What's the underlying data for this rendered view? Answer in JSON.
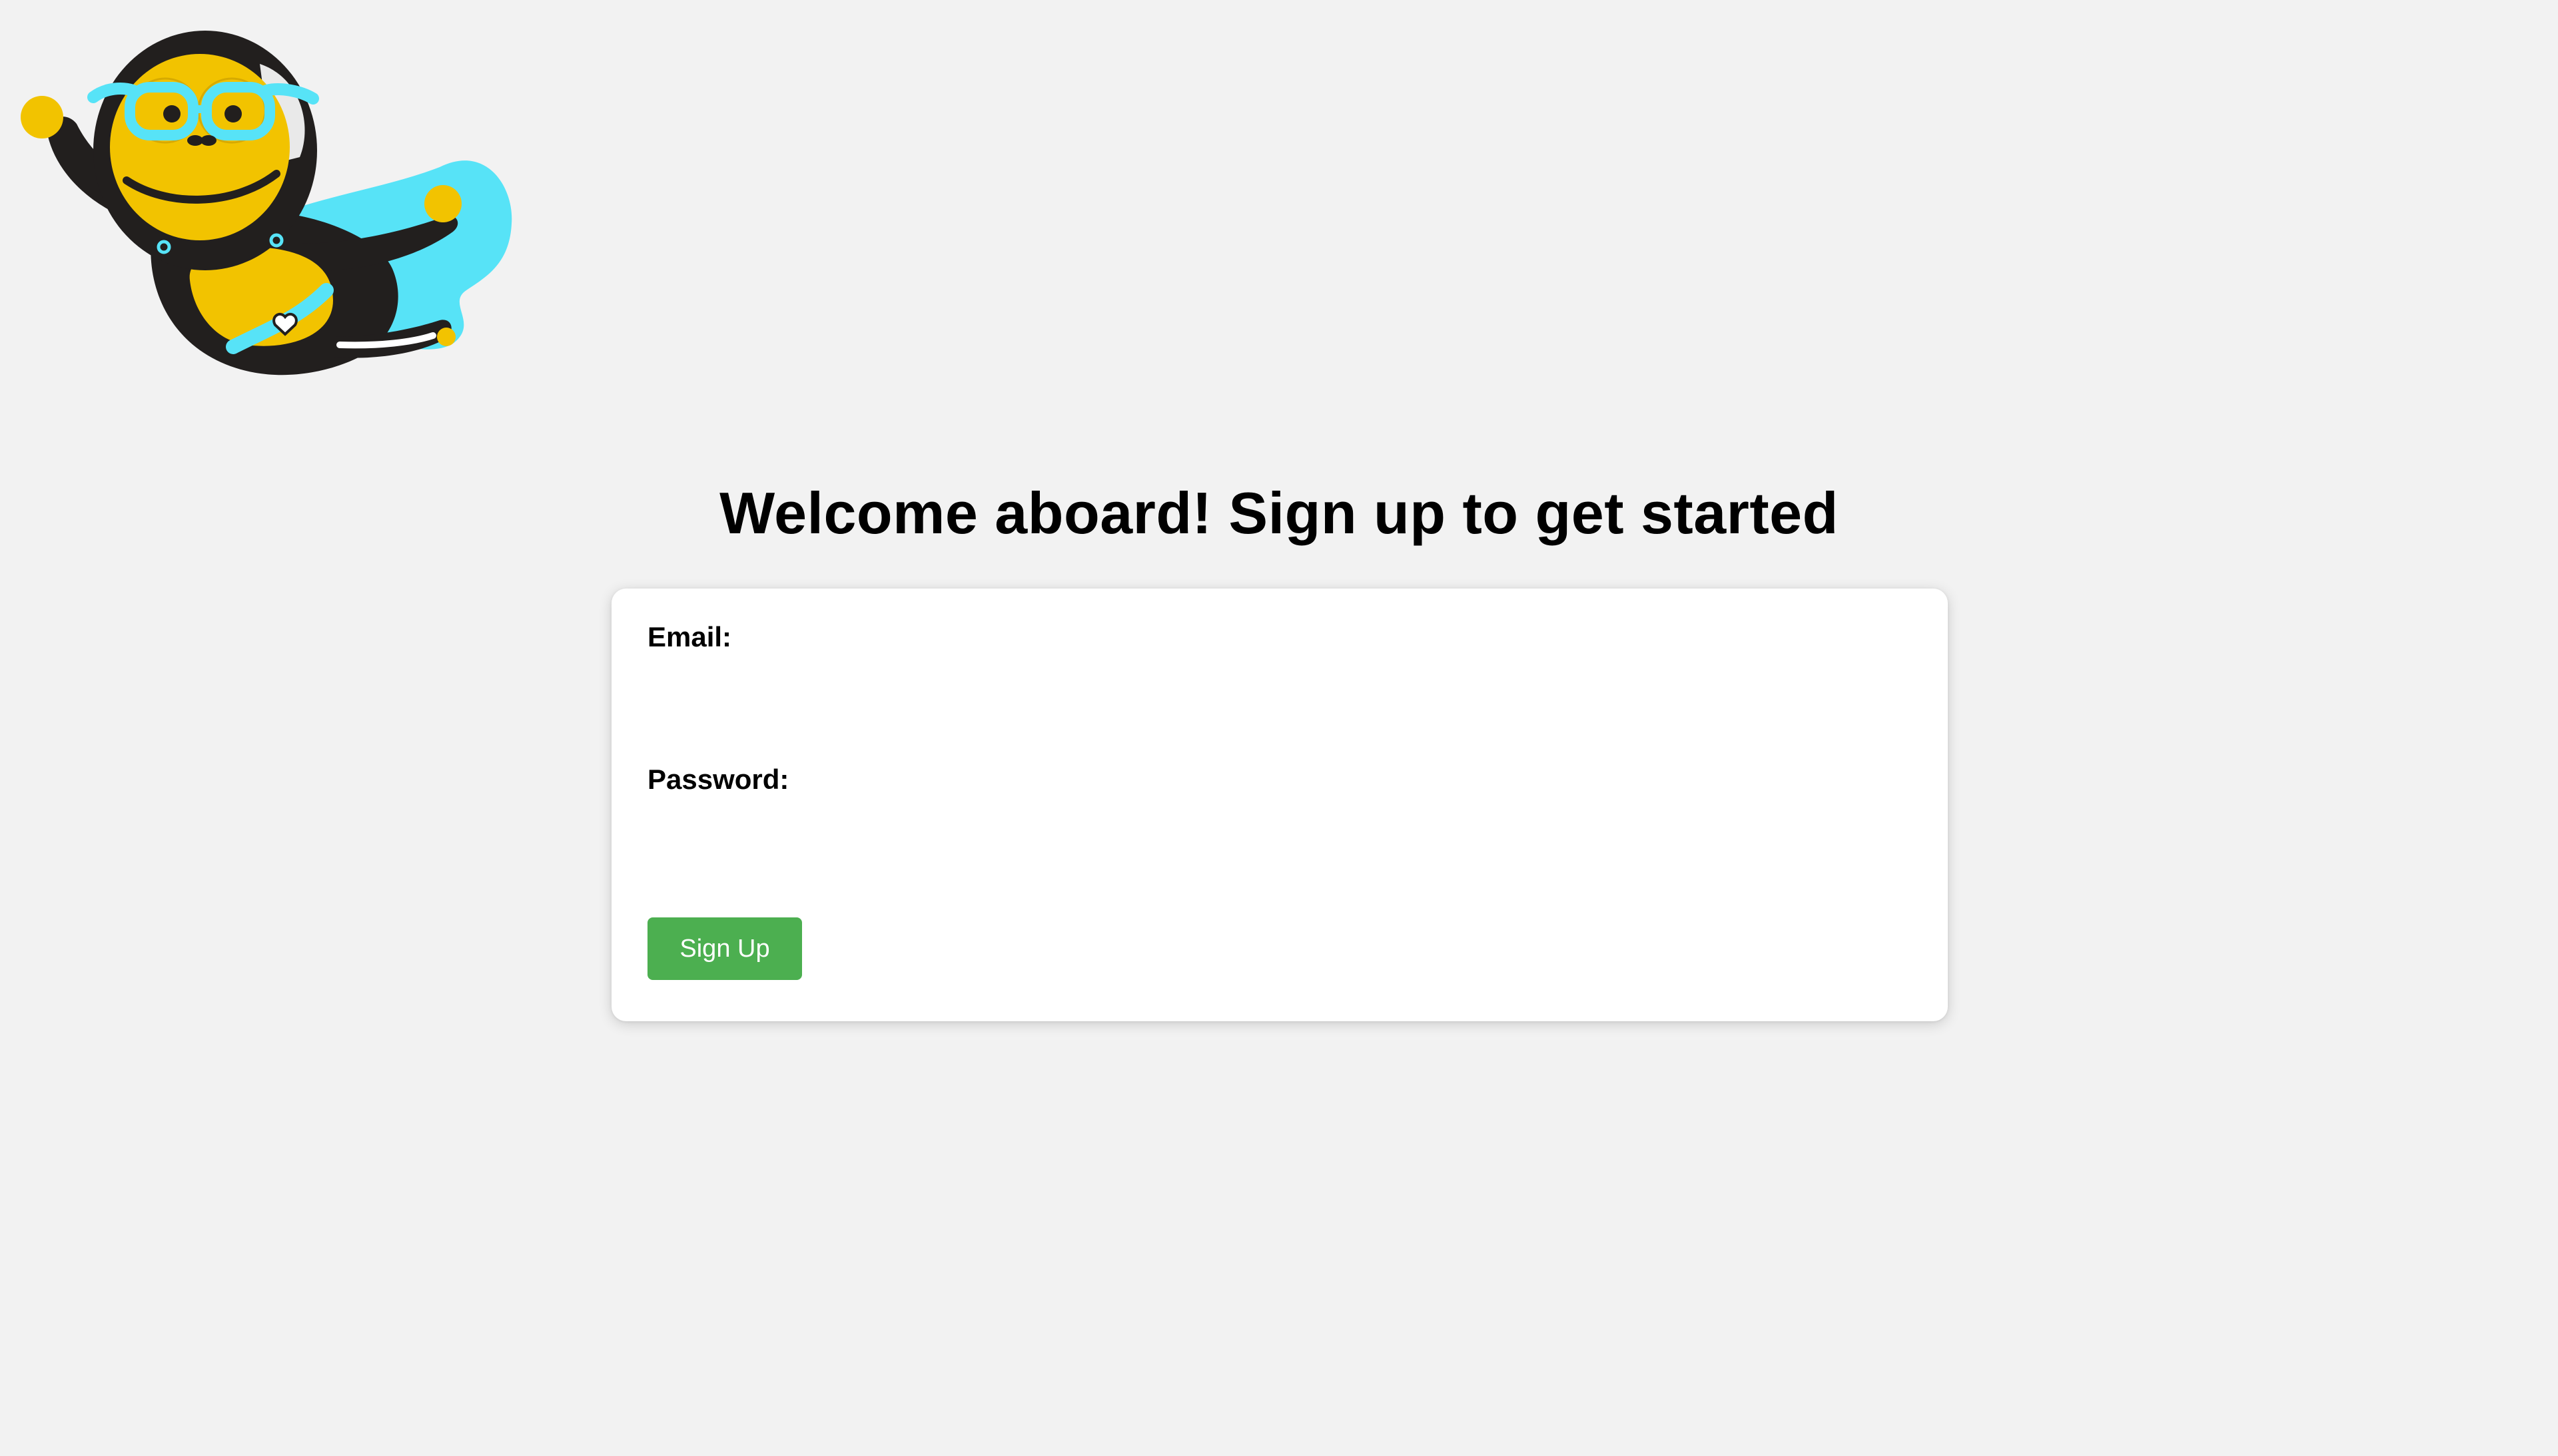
{
  "page": {
    "title": "Welcome aboard! Sign up to get started"
  },
  "logo": {
    "icon": "superhero-monkey-mascot"
  },
  "form": {
    "email_label": "Email:",
    "email_value": "",
    "email_placeholder": "",
    "password_label": "Password:",
    "password_value": "",
    "password_placeholder": "",
    "submit_label": "Sign Up"
  },
  "colors": {
    "background": "#f2f2f2",
    "card": "#ffffff",
    "button": "#4caf50",
    "button_text": "#ffffff",
    "mascot_yellow": "#f2c300",
    "mascot_cape": "#57e3f7",
    "mascot_fur": "#221f1e"
  }
}
